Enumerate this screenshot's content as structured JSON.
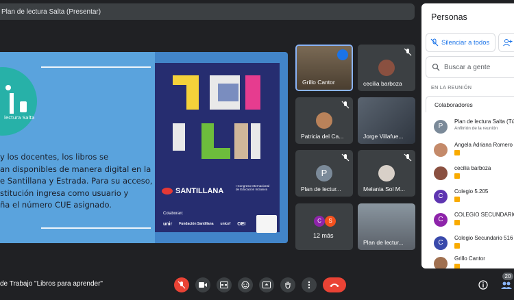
{
  "meeting": {
    "presenter_title": "Plan de lectura Salta (Presentar)",
    "name": "de Trabajo \"Libros para aprender\""
  },
  "slide": {
    "logo_text": "lectura Salta",
    "body_lines": [
      "y los docentes, los libros se",
      "an disponibles de manera digital en la",
      "e Santillana y Estrada. Para su acceso,",
      "stitución ingresa como usuario y",
      "ña el número CUE asignado."
    ],
    "brand": "SANTILLANA",
    "congress": "I Congreso Internacional de Educación Inclusiva",
    "collaborators_label": "Colaboran:",
    "sponsors": [
      "unir",
      "Fundación Santillana",
      "unicef",
      "OEI"
    ]
  },
  "tiles": [
    {
      "name": "Grillo Cantor"
    },
    {
      "name": "cecilia barboza"
    },
    {
      "name": "Patricia del Ca..."
    },
    {
      "name": "Jorge Villafue..."
    },
    {
      "name": "Plan de lectur...",
      "initial": "P"
    },
    {
      "name": "Melania Sol M..."
    },
    {
      "more_label": "12 más",
      "avatars": [
        "C",
        "S"
      ]
    },
    {
      "name": "Plan de lectur..."
    }
  ],
  "panel": {
    "title": "Personas",
    "mute_all": "Silenciar a todos",
    "search_placeholder": "Buscar a gente",
    "section": "EN LA REUNIÓN",
    "group": "Colaboradores",
    "people": [
      {
        "name": "Plan de lectura Salta (Tú)",
        "role": "Anfitrión de la reunión",
        "initial": "P",
        "color": "#7b8a99"
      },
      {
        "name": "Angela Adriana Romero",
        "initial": "",
        "color": "#c48a6a"
      },
      {
        "name": "cecilia barboza",
        "initial": "",
        "color": "#8a5040"
      },
      {
        "name": "Colegio 5.205",
        "initial": "C",
        "color": "#5e35b1"
      },
      {
        "name": "COLEGIO SECUNDARIO",
        "initial": "C",
        "color": "#8e24aa"
      },
      {
        "name": "Colegio Secundario 516",
        "initial": "C",
        "color": "#3949ab"
      },
      {
        "name": "Grillo Cantor",
        "initial": "",
        "color": "#a07050"
      }
    ]
  },
  "participant_count": "20",
  "colors": {
    "hangup": "#ea4335",
    "accent": "#1a73e8",
    "slide_bg": "#4285c9"
  }
}
